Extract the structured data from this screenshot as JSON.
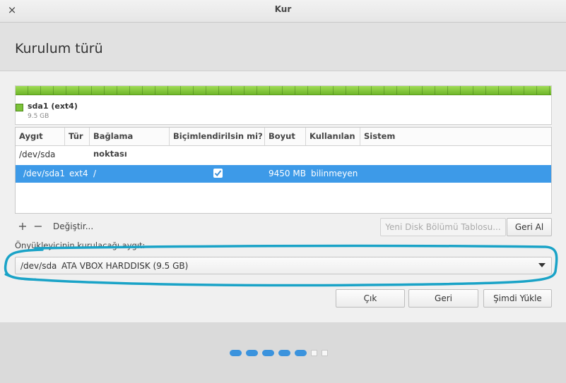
{
  "window": {
    "title": "Kur",
    "close_icon": "×"
  },
  "header": {
    "title": "Kurulum türü"
  },
  "partition_bar": {
    "name": "sda1 (ext4)",
    "size": "9.5 GB",
    "color": "#7cc33a"
  },
  "table": {
    "columns": [
      "Aygıt",
      "Tür",
      "Bağlama noktası",
      "Biçimlendirilsin mi?",
      "Boyut",
      "Kullanılan",
      "Sistem"
    ],
    "rows": [
      {
        "device": "/dev/sda"
      },
      {
        "device": "/dev/sda1",
        "type": "ext4",
        "mount": "/",
        "format": true,
        "size": "9450 MB",
        "used": "bilinmeyen",
        "system": ""
      }
    ]
  },
  "toolbar": {
    "add_icon": "+",
    "remove_icon": "−",
    "change_label": "Değiştir...",
    "new_table_label": "Yeni Disk Bölümü Tablosu...",
    "revert_label": "Geri Al"
  },
  "bootloader": {
    "label": "Önyükleyicinin kurulacağı aygıt:",
    "device": "/dev/sda",
    "name": "ATA VBOX HARDDISK (9.5 GB)"
  },
  "buttons": {
    "quit": "Çık",
    "back": "Geri",
    "install": "Şimdi Yükle"
  },
  "progress": {
    "completed_steps": 5,
    "total_steps": 7,
    "active_color": "#3b93dd"
  },
  "annotation_color": "#1aa3c7"
}
